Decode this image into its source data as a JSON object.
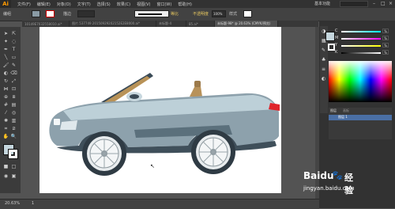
{
  "app": {
    "logo": "Ai",
    "workspace": "基本功能"
  },
  "menu": [
    "文件(F)",
    "编辑(E)",
    "对象(O)",
    "文字(T)",
    "选择(S)",
    "效果(C)",
    "视图(V)",
    "窗口(W)",
    "帮助(H)"
  ],
  "control_bar": {
    "label": "编组",
    "stroke_label": "描边",
    "style_label": "等比",
    "opacity_label": "不透明度",
    "opacity_value": "100%",
    "style2_label": "样式"
  },
  "tabs": [
    "10149E7032558010.ai*",
    "图片.537749 20150929202152E2E8000.ai*",
    "未标题-4",
    "85.ai*",
    "未标题-98* @ 20.63% (CMYK/预览)"
  ],
  "status": {
    "zoom": "20.63%",
    "page": "1"
  },
  "color_panel": {
    "channels": [
      {
        "label": "C",
        "value": "%"
      },
      {
        "label": "M",
        "value": "%"
      },
      {
        "label": "Y",
        "value": "%"
      },
      {
        "label": "K",
        "value": "%"
      }
    ]
  },
  "layers": {
    "tabs": [
      "图层",
      "画板"
    ],
    "row": "图层 1"
  },
  "watermark": {
    "brand": "Baidu",
    "cn": "经验",
    "url": "jingyan.baidu.com"
  }
}
